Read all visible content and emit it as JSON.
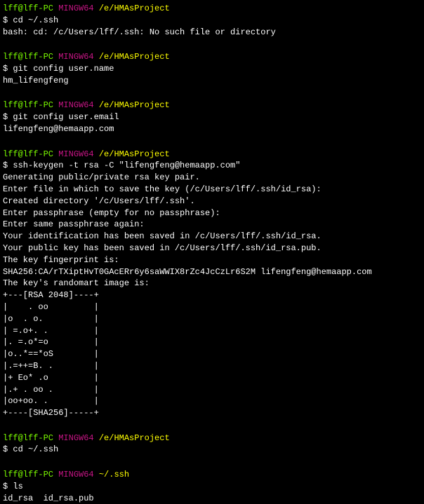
{
  "prompt": {
    "user": "lff@lff-PC",
    "mingw": "MINGW64",
    "path1": "/e/HMAsProject",
    "path2": "~/.ssh",
    "dollar": "$"
  },
  "block1": {
    "cmd": "cd ~/.ssh",
    "out": "bash: cd: /c/Users/lff/.ssh: No such file or directory"
  },
  "block2": {
    "cmd": "git config user.name",
    "out": "hm_lifengfeng"
  },
  "block3": {
    "cmd": "git config user.email",
    "out": "lifengfeng@hemaapp.com"
  },
  "block4": {
    "cmd": "ssh-keygen -t rsa -C \"lifengfeng@hemaapp.com\"",
    "l1": "Generating public/private rsa key pair.",
    "l2": "Enter file in which to save the key (/c/Users/lff/.ssh/id_rsa):",
    "l3": "Created directory '/c/Users/lff/.ssh'.",
    "l4": "Enter passphrase (empty for no passphrase):",
    "l5": "Enter same passphrase again:",
    "l6": "Your identification has been saved in /c/Users/lff/.ssh/id_rsa.",
    "l7": "Your public key has been saved in /c/Users/lff/.ssh/id_rsa.pub.",
    "l8": "The key fingerprint is:",
    "l9": "SHA256:CA/rTXiptHvT0GAcERr6y6saWWIX8rZc4JcCzLr6S2M lifengfeng@hemaapp.com",
    "l10": "The key's randomart image is:",
    "r1": "+---[RSA 2048]----+",
    "r2": "|    . oo         |",
    "r3": "|o  . o.          |",
    "r4": "| =.o+. .         |",
    "r5": "|. =.o*=o         |",
    "r6": "|o..*==*oS        |",
    "r7": "|.=++=B. .        |",
    "r8": "|+ Eo* .o         |",
    "r9": "|.+ . oo .        |",
    "r10": "|oo+oo. .         |",
    "r11": "+----[SHA256]-----+"
  },
  "block5": {
    "cmd": "cd ~/.ssh"
  },
  "block6": {
    "cmd": "ls",
    "out": "id_rsa  id_rsa.pub"
  }
}
